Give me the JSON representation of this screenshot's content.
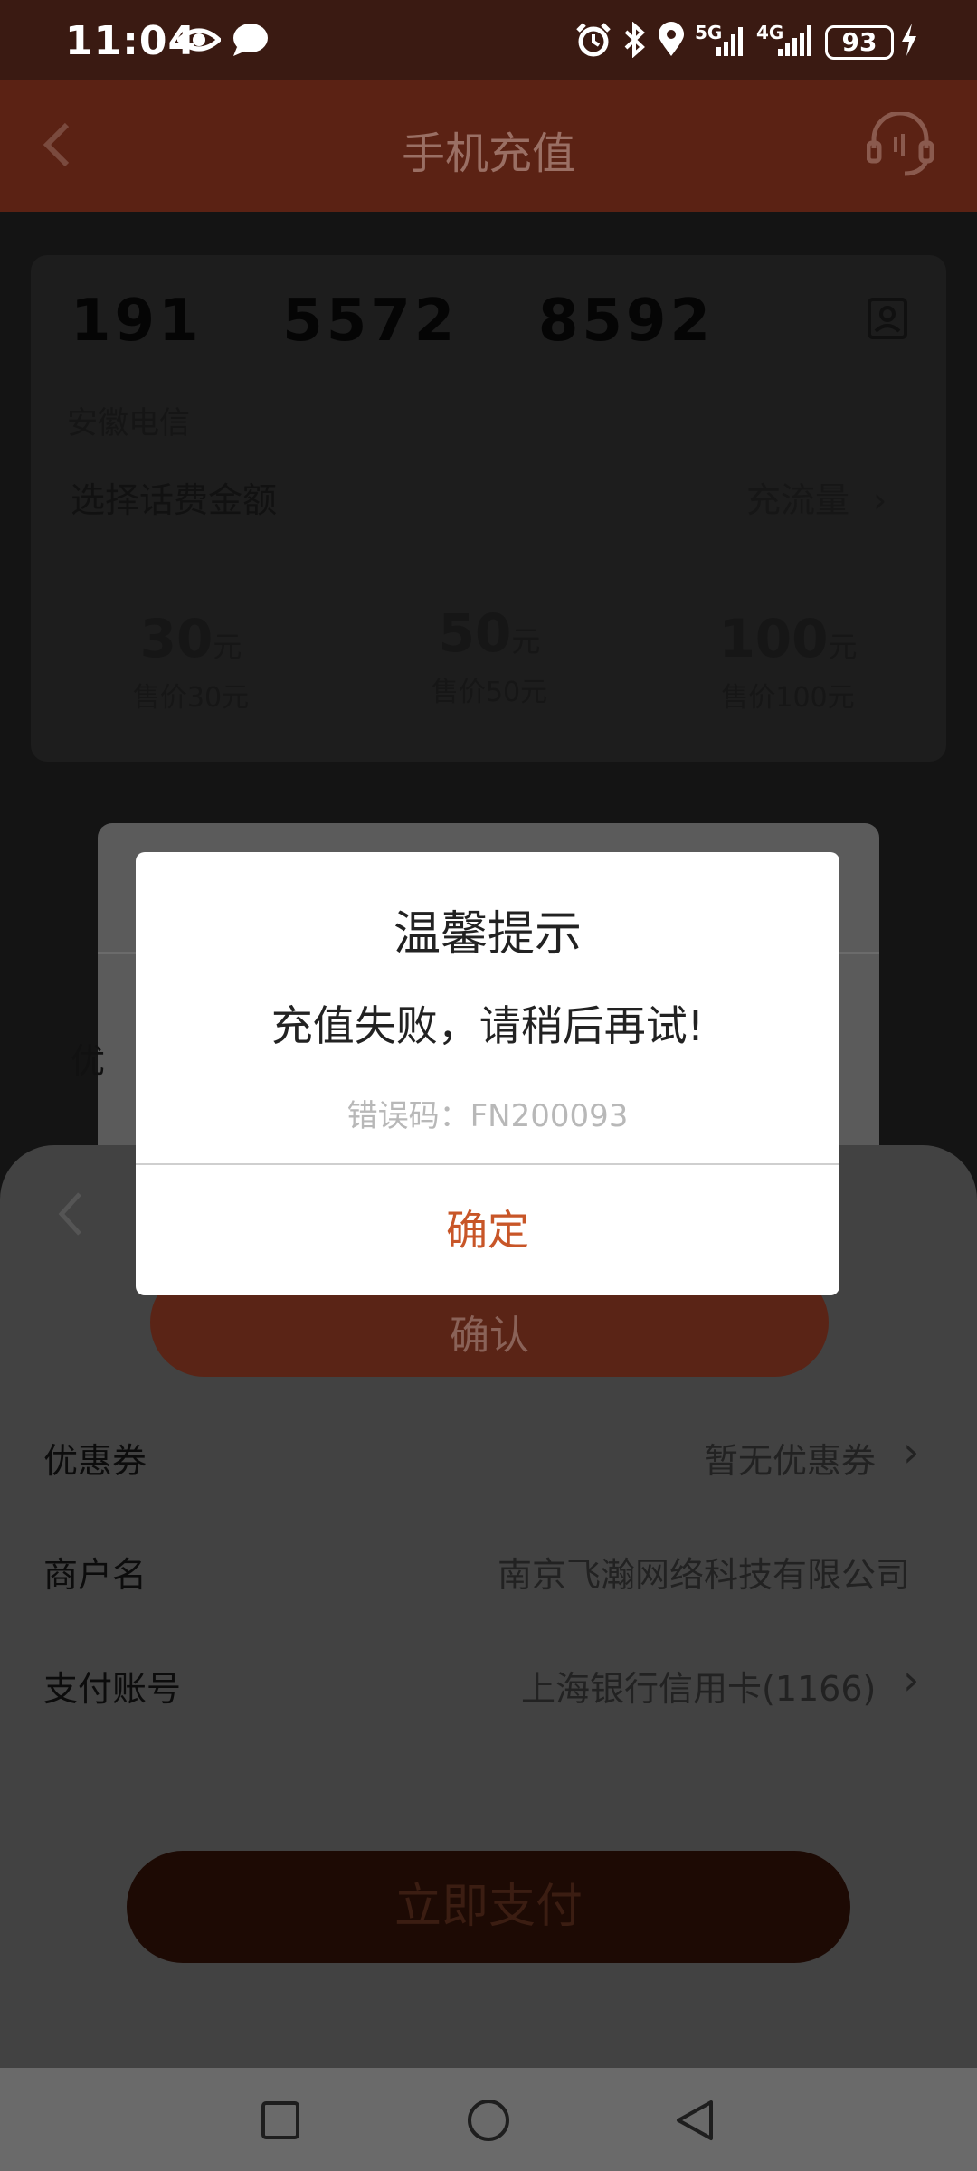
{
  "status_bar": {
    "time": "11:04",
    "network1": "5G",
    "network2": "4G",
    "battery": "93"
  },
  "header": {
    "title": "手机充值"
  },
  "recharge": {
    "phone_number": "191  5572  8592",
    "carrier": "安徽电信",
    "select_label": "选择话费金额",
    "data_link": "充流量",
    "amounts": [
      {
        "value": "30",
        "unit": "元",
        "price": "售价30元"
      },
      {
        "value": "50",
        "unit": "元",
        "price": "售价50元"
      },
      {
        "value": "100",
        "unit": "元",
        "price": "售价100元"
      }
    ],
    "coupon_partial": "优"
  },
  "sheet": {
    "confirm_label": "确认",
    "rows": [
      {
        "label": "优惠券",
        "value": "暂无优惠券"
      },
      {
        "label": "商户名",
        "value": "南京飞瀚网络科技有限公司"
      },
      {
        "label": "支付账号",
        "value": "上海银行信用卡(1166)"
      }
    ],
    "pay_button": "立即支付"
  },
  "modal": {
    "title": "温馨提示",
    "message": "充值失败，请稍后再试!",
    "error_code": "错误码：FN200093",
    "ok_label": "确定"
  },
  "colors": {
    "accent": "#c85628",
    "header": "#5b2214"
  }
}
